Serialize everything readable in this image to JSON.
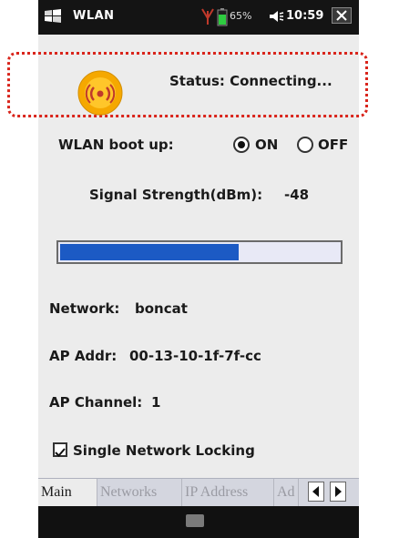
{
  "statusbar": {
    "app_title": "WLAN",
    "battery_text": "65%",
    "clock": "10:59",
    "icons": [
      "windows-start-icon",
      "signal-icon",
      "battery-icon",
      "volume-icon",
      "close-icon"
    ]
  },
  "status": {
    "text": "Status: Connecting..."
  },
  "boot": {
    "label": "WLAN boot up:",
    "on_label": "ON",
    "off_label": "OFF",
    "selected": "ON"
  },
  "signal": {
    "label": "Signal Strength(dBm):",
    "value": "-48"
  },
  "signal_bar": {
    "fraction": 0.64
  },
  "network": {
    "label": "Network:",
    "value": "boncat"
  },
  "ap_addr": {
    "label": "AP Addr:",
    "value": "00-13-10-1f-7f-cc"
  },
  "ap_channel": {
    "label": "AP Channel:",
    "value": "1"
  },
  "single_lock": {
    "label": "Single Network Locking",
    "checked": true
  },
  "tabs": [
    {
      "label": "Main",
      "active": true
    },
    {
      "label": "Networks",
      "active": false
    },
    {
      "label": "IP Address",
      "active": false
    },
    {
      "label": "Ad",
      "active": false
    }
  ],
  "colors": {
    "highlight": "#d9251c",
    "progress_fill": "#1c5ac4",
    "wifi_icon": "#f5a800"
  }
}
